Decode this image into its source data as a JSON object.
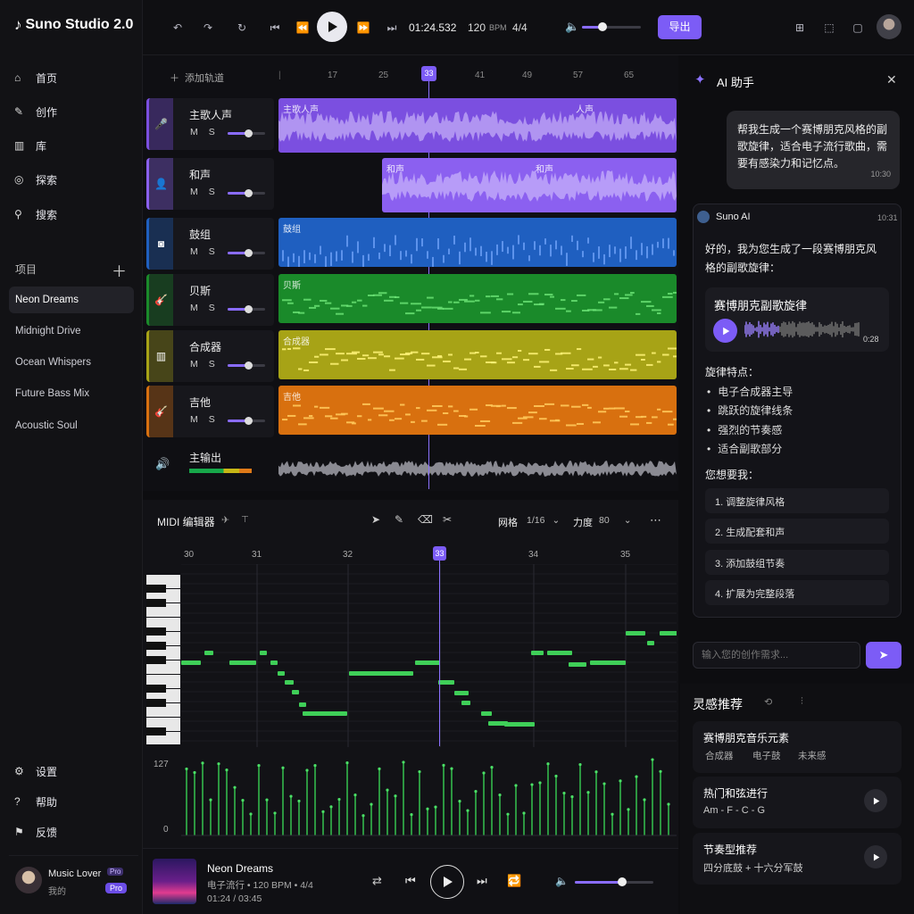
{
  "app": {
    "title": "Suno Studio 2.0"
  },
  "nav": [
    {
      "label": "首页",
      "icon": "home-icon"
    },
    {
      "label": "创作",
      "icon": "pencil-icon"
    },
    {
      "label": "库",
      "icon": "library-icon"
    },
    {
      "label": "探索",
      "icon": "compass-icon"
    },
    {
      "label": "搜索",
      "icon": "search-icon"
    }
  ],
  "projects": {
    "title": "项目",
    "items": [
      "Neon Dreams",
      "Midnight Drive",
      "Ocean Whispers",
      "Future Bass Mix",
      "Acoustic Soul"
    ]
  },
  "footer_nav": [
    {
      "label": "设置",
      "icon": "gear-icon"
    },
    {
      "label": "帮助",
      "icon": "help-icon"
    },
    {
      "label": "反馈",
      "icon": "feedback-icon"
    }
  ],
  "user": {
    "name": "Music Lover",
    "badge": "Pro",
    "sub": "我的",
    "tag": "Pro"
  },
  "transport": {
    "time": "01:24.532",
    "bpm": "120",
    "bpm_label": "BPM",
    "signature": "4/4",
    "export_label": "导出",
    "volume": 0.35
  },
  "timeline": {
    "add_track": "添加轨道",
    "ticks": [
      "17",
      "25",
      "33",
      "41",
      "49",
      "57",
      "65"
    ],
    "playhead": "33"
  },
  "tracks": [
    {
      "name": "主歌人声",
      "mute": "M",
      "solo": "S",
      "color": "#7b4fe0",
      "clip_label": "主歌人声",
      "clip_label2": "人声",
      "icon": "mic-icon",
      "volume": 0.55
    },
    {
      "name": "和声",
      "mute": "M",
      "solo": "S",
      "color": "#8b60f0",
      "clip_label": "和声",
      "clip_label2": "和声",
      "icon": "user-icon",
      "volume": 0.55
    },
    {
      "name": "鼓组",
      "mute": "M",
      "solo": "S",
      "color": "#1f5fc0",
      "clip_label": "鼓组",
      "icon": "drum-icon",
      "volume": 0.55
    },
    {
      "name": "贝斯",
      "mute": "M",
      "solo": "S",
      "color": "#1a8a2a",
      "clip_label": "贝斯",
      "icon": "bass-icon",
      "volume": 0.55
    },
    {
      "name": "合成器",
      "mute": "M",
      "solo": "S",
      "color": "#a7a316",
      "clip_label": "合成器",
      "icon": "synth-icon",
      "volume": 0.55
    },
    {
      "name": "吉他",
      "mute": "M",
      "solo": "S",
      "color": "#d8700f",
      "clip_label": "吉他",
      "icon": "guitar-icon",
      "volume": 0.55
    }
  ],
  "master": {
    "name": "主输出"
  },
  "midi": {
    "title": "MIDI 编辑器",
    "grid_label": "网格",
    "grid_value": "1/16",
    "velocity_label": "力度",
    "velocity_value": "80",
    "ticks": [
      "30",
      "31",
      "32",
      "33",
      "34",
      "35"
    ],
    "vel_max": "127",
    "vel_min": "0"
  },
  "assistant": {
    "title": "AI 助手",
    "user_msg": "帮我生成一个赛博朋克风格的副歌旋律，适合电子流行歌曲，需要有感染力和记忆点。",
    "user_time": "10:30",
    "bot_name": "Suno AI",
    "bot_time": "10:31",
    "bot_msg": "好的，我为您生成了一段赛博朋克风格的副歌旋律：",
    "clip_title": "赛博朋克副歌旋律",
    "clip_duration": "0:28",
    "features_title": "旋律特点：",
    "features": [
      "电子合成器主导",
      "跳跃的旋律线条",
      "强烈的节奏感",
      "适合副歌部分"
    ],
    "ask": "您想要我：",
    "options": [
      "1. 调整旋律风格",
      "2. 生成配套和声",
      "3. 添加鼓组节奏",
      "4. 扩展为完整段落"
    ],
    "input_placeholder": "输入您的创作需求..."
  },
  "inspiration": {
    "title": "灵感推荐",
    "cards": [
      {
        "title": "赛博朋克音乐元素",
        "tags": [
          "合成器",
          "电子鼓",
          "未来感"
        ]
      },
      {
        "title": "热门和弦进行",
        "sub": "Am - F - C - G"
      },
      {
        "title": "节奏型推荐",
        "sub": "四分底鼓 + 十六分军鼓"
      }
    ]
  },
  "player": {
    "title": "Neon Dreams",
    "meta": "电子流行 • 120 BPM • 4/4",
    "time": "01:24 / 03:45",
    "volume": 0.6
  },
  "colors": {
    "accent": "#7c5cf6",
    "bg": "#0d0d10"
  }
}
